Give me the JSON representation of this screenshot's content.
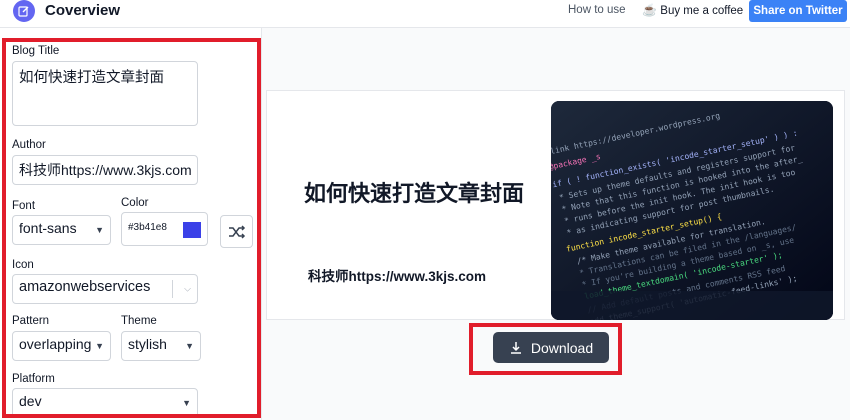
{
  "header": {
    "app_title": "Coverview",
    "how_to_use": "How to use",
    "coffee": "Buy me a coffee",
    "share": "Share on Twitter"
  },
  "form": {
    "blog_title_label": "Blog Title",
    "blog_title_value": "如何快速打造文章封面",
    "author_label": "Author",
    "author_value": "科技师https://www.3kjs.com",
    "font_label": "Font",
    "font_value": "font-sans",
    "color_label": "Color",
    "color_value": "#3b41e8",
    "icon_label": "Icon",
    "icon_value": "amazonwebservices",
    "pattern_label": "Pattern",
    "pattern_value": "overlapping",
    "theme_label": "Theme",
    "theme_value": "stylish",
    "platform_label": "Platform",
    "platform_value": "dev"
  },
  "preview": {
    "title": "如何快速打造文章封面",
    "author": "科技师https://www.3kjs.com"
  },
  "download_label": "Download",
  "colors": {
    "accent": "#3b41e8",
    "button": "#374151",
    "annotation": "#e11d2b"
  }
}
